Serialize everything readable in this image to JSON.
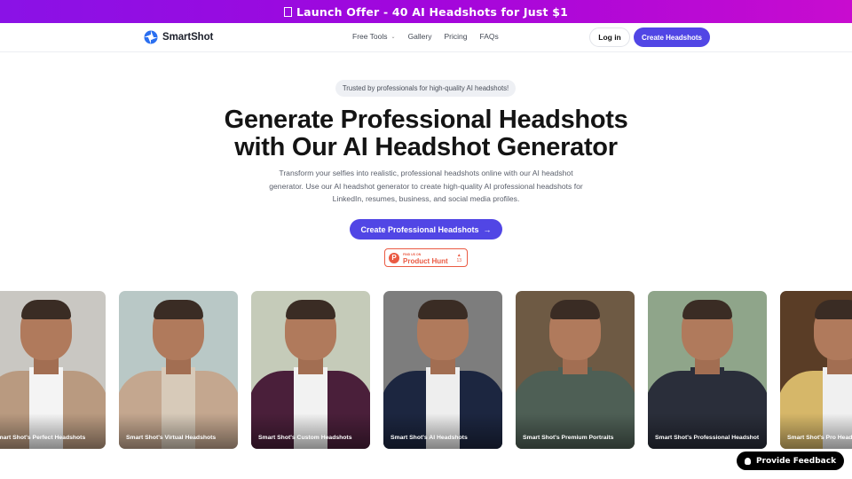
{
  "banner": {
    "icon": "gift-icon",
    "text": "Launch Offer - 40 AI Headshots for Just $1"
  },
  "nav": {
    "brand": "SmartShot",
    "items": [
      {
        "label": "Free Tools",
        "has_dropdown": true
      },
      {
        "label": "Gallery"
      },
      {
        "label": "Pricing"
      },
      {
        "label": "FAQs"
      }
    ],
    "login_label": "Log in",
    "cta_label": "Create Headshots"
  },
  "hero": {
    "trusted_badge": "Trusted by professionals for high-quality AI headshots!",
    "headline_line1": "Generate Professional Headshots",
    "headline_line2": "with Our AI Headshot Generator",
    "subtext": "Transform your selfies into realistic, professional headshots online with our AI headshot generator. Use our AI headshot generator to create high-quality AI professional headshots for LinkedIn, resumes, business, and social media profiles.",
    "cta_label": "Create Professional Headshots",
    "cta_icon": "arrow-right-icon",
    "product_hunt": {
      "find_label": "FIND US ON",
      "name": "Product Hunt",
      "votes": "13"
    }
  },
  "gallery": [
    {
      "caption": "Smart Shot's Perfect Headshots",
      "bg": "#c9c7c2",
      "outfit": "#b99a80",
      "shirt": "#f4f4f4"
    },
    {
      "caption": "Smart Shot's Virtual Headshots",
      "bg": "#b9c8c6",
      "outfit": "#c4a78f",
      "shirt": "#d7cab9"
    },
    {
      "caption": "Smart Shot's Custom Headshots",
      "bg": "#c5cbb9",
      "outfit": "#4a1f3a",
      "shirt": "#f2f2f2"
    },
    {
      "caption": "Smart Shot's AI Headshots",
      "bg": "#7d7d7d",
      "outfit": "#1c2640",
      "shirt": "#eeeeee"
    },
    {
      "caption": "Smart Shot's Premium Portraits",
      "bg": "#6e5a44",
      "outfit": "#4e5f55",
      "shirt": "#4e5f55"
    },
    {
      "caption": "Smart Shot's Professional Headshot",
      "bg": "#8fa58a",
      "outfit": "#2a2e3a",
      "shirt": "#2a2e3a"
    },
    {
      "caption": "Smart Shot's Pro Headshots",
      "bg": "#5a3d26",
      "outfit": "#d6b769",
      "shirt": "#f0f0f0"
    }
  ],
  "feedback": {
    "icon": "lightbulb-icon",
    "label": "Provide Feedback"
  },
  "colors": {
    "primary": "#5146e5",
    "banner_start": "#8a12e6",
    "banner_end": "#c80ccf",
    "producthunt": "#ea5a43"
  }
}
